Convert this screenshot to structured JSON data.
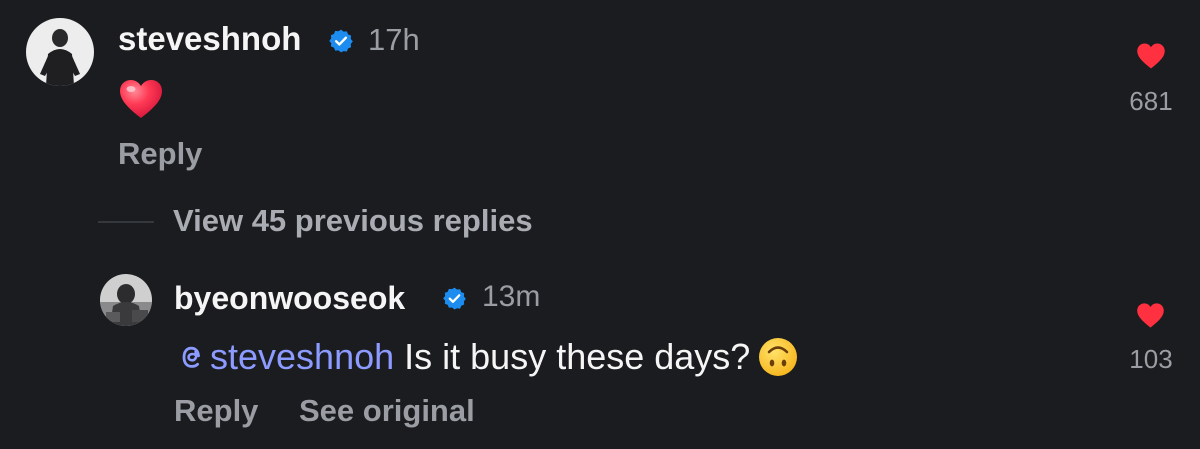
{
  "comment1": {
    "username": "steveshnoh",
    "timestamp": "17h",
    "emoji": "heart",
    "reply_label": "Reply",
    "like_count": "681"
  },
  "view_replies_label": "View 45 previous replies",
  "comment2": {
    "username": "byeonwooseok",
    "timestamp": "13m",
    "mention": "steveshnoh",
    "text": " Is it busy these days?",
    "emoji": "upside-down-face",
    "reply_label": "Reply",
    "see_original_label": "See original",
    "like_count": "103"
  },
  "colors": {
    "background": "#1a1c1f",
    "heart": "#ff3040",
    "verified": "#1d8cf0",
    "mention": "#8c9bff",
    "muted": "#9a9da3"
  }
}
